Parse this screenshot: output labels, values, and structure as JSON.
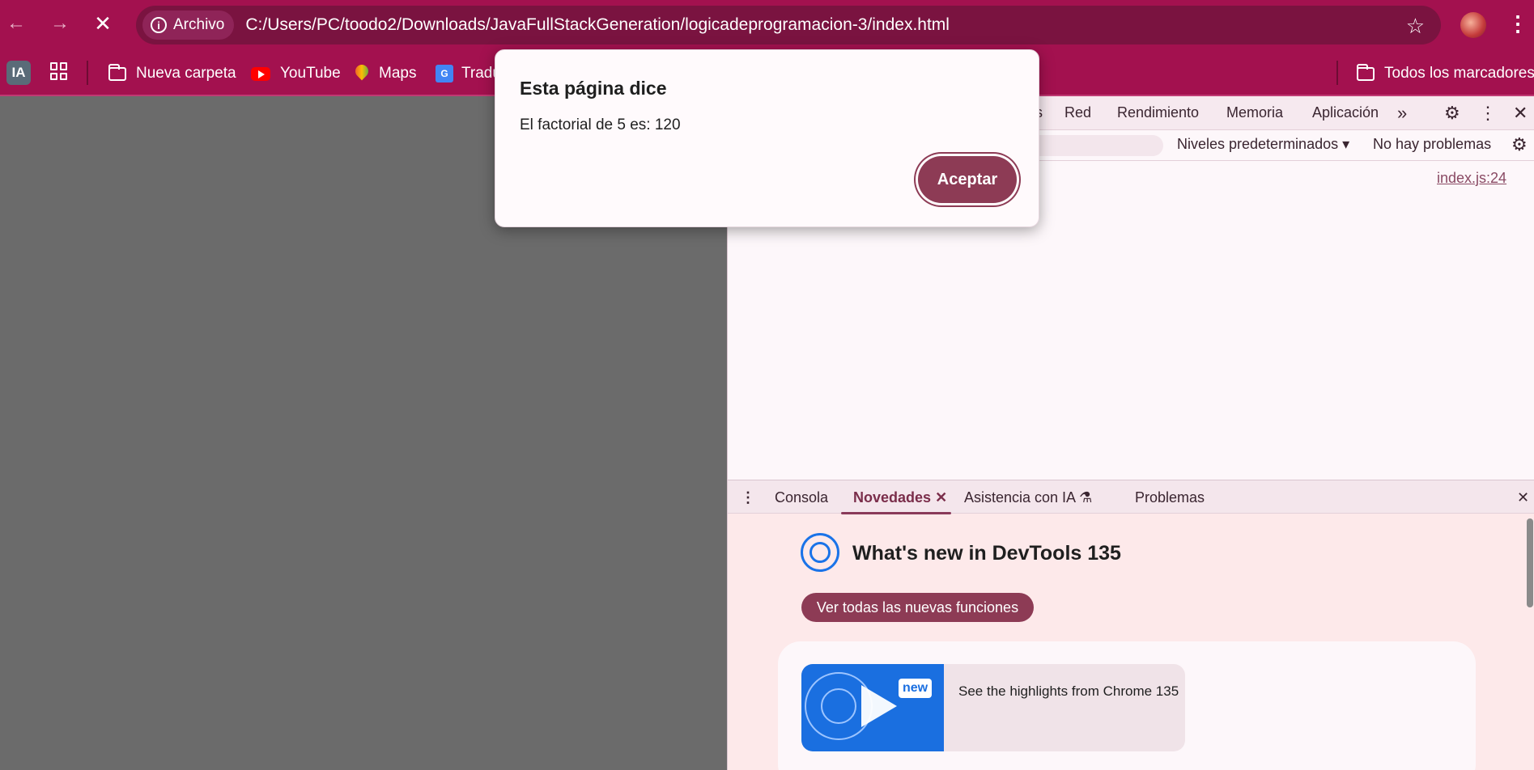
{
  "browser": {
    "security_chip": "Archivo",
    "url": "C:/Users/PC/toodo2/Downloads/JavaFullStackGeneration/logicadeprogramacion-3/index.html"
  },
  "bookmarks": {
    "ia_label": "IA",
    "items": [
      "Nueva carpeta",
      "YouTube",
      "Maps",
      "Tradu"
    ],
    "all_bookmarks": "Todos los marcadores"
  },
  "devtools": {
    "tabs": [
      "s",
      "Red",
      "Rendimiento",
      "Memoria",
      "Aplicación"
    ],
    "levels": "Niveles predeterminados",
    "issues": "No hay problemas",
    "source_link": "index.js:24",
    "drawer_tabs": {
      "console": "Consola",
      "whats_new": "Novedades",
      "ai": "Asistencia con IA",
      "problems": "Problemas"
    },
    "whats_new": {
      "title": "What's new in DevTools 135",
      "button": "Ver todas las nuevas funciones",
      "badge": "new",
      "video_text": "See the highlights from Chrome 135"
    }
  },
  "dialog": {
    "title": "Esta página dice",
    "message": "El factorial de 5 es: 120",
    "ok_button": "Aceptar"
  },
  "colors": {
    "browser_frame": "#a3114f",
    "accent_button": "#8d3b55",
    "page_overlay": "#6b6b6b"
  }
}
